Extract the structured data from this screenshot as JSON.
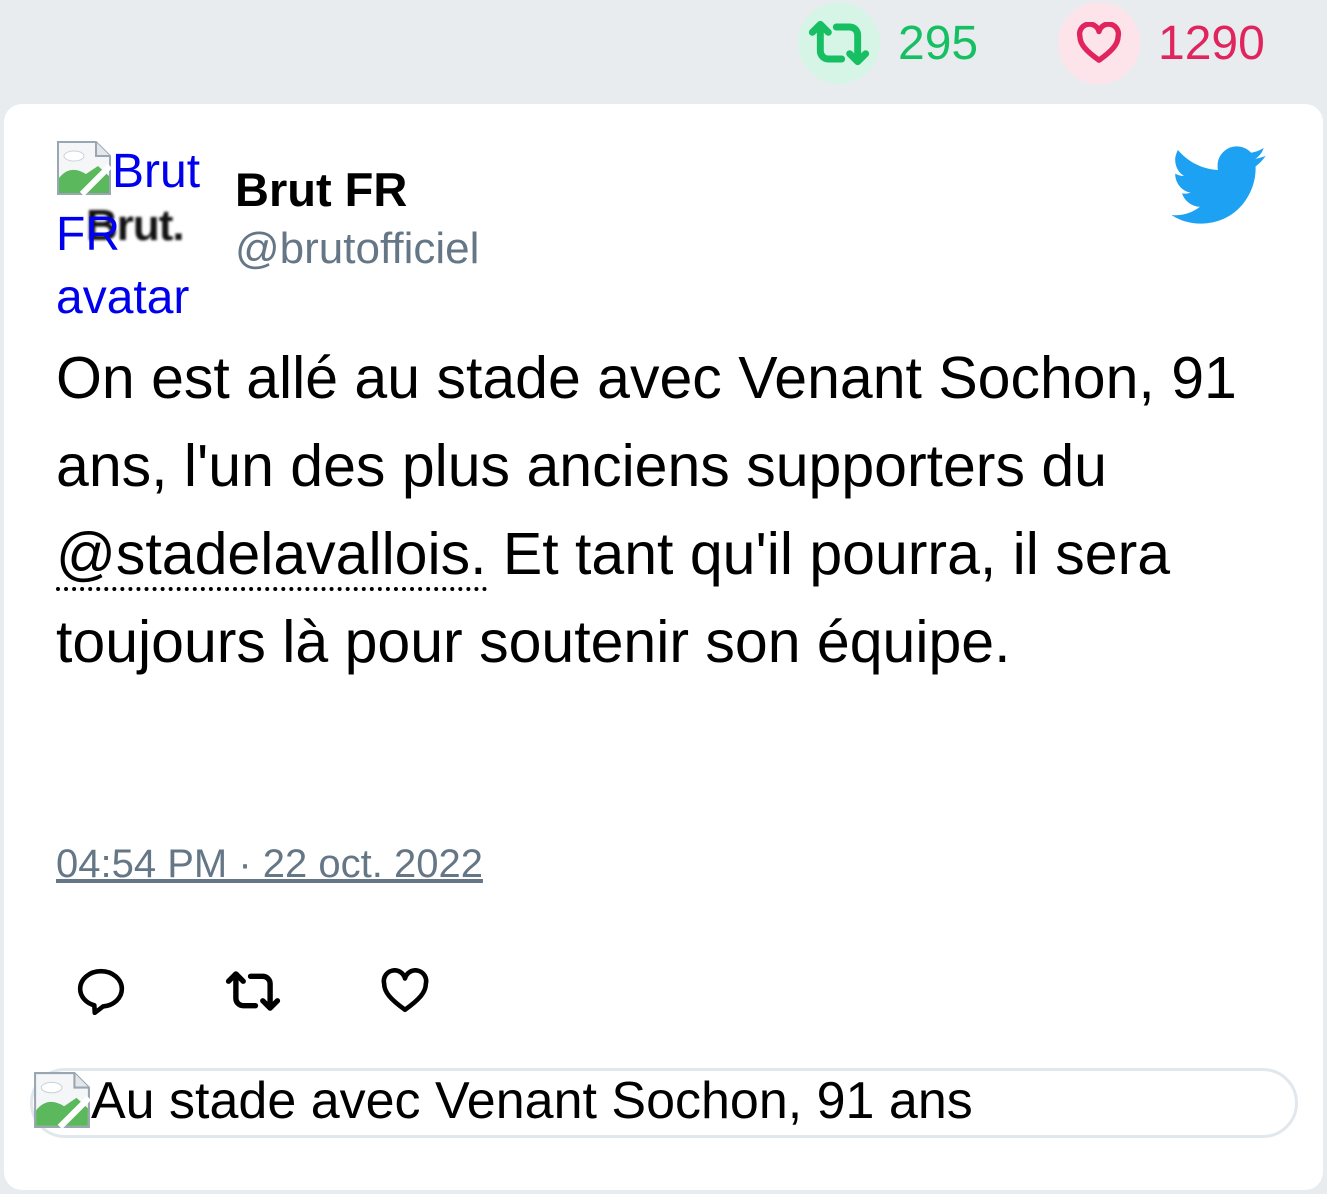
{
  "stats": {
    "retweets": "295",
    "likes": "1290"
  },
  "tweet": {
    "avatar_alt": "Brut FR avatar",
    "avatar_brand": "Brut.",
    "author_name": "Brut FR",
    "author_handle": "@brutofficiel",
    "text_part1": "On est allé au stade avec Venant Sochon, 91 ans, l'un des plus anciens supporters du ",
    "mention": "@stadelavallois.",
    "text_part2": " Et tant qu'il pourra, il sera toujours là pour soutenir son équipe.",
    "timestamp": "04:54 PM · 22 oct. 2022"
  },
  "preview": {
    "title": "Au stade avec Venant Sochon, 91 ans"
  },
  "colors": {
    "retweet": "#17bf63",
    "like": "#e0245e",
    "twitter_blue": "#1da1f2",
    "muted": "#657786"
  },
  "icons": [
    "retweet-icon",
    "heart-icon",
    "twitter-bird-icon",
    "reply-icon",
    "broken-image-icon"
  ]
}
